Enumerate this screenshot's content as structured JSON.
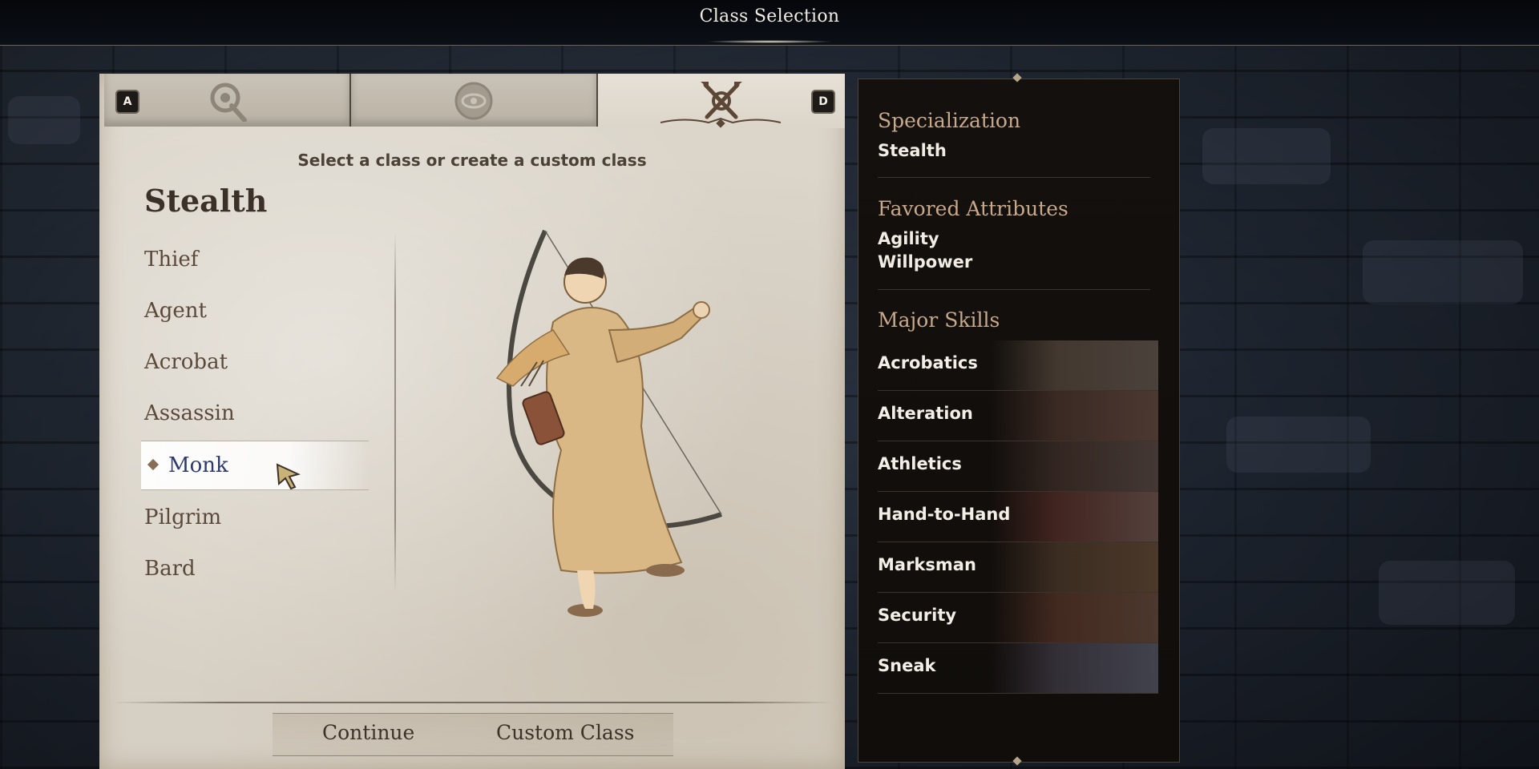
{
  "header": {
    "title": "Class Selection"
  },
  "tabs": {
    "left_key": "A",
    "right_key": "D",
    "items": [
      {
        "icon": "combat-axe-icon"
      },
      {
        "icon": "magic-eye-icon"
      },
      {
        "icon": "stealth-crossed-arrows-icon"
      }
    ],
    "active_index": 2
  },
  "class_panel": {
    "instruction": "Select a class or create a custom class",
    "category": "Stealth",
    "classes": [
      "Thief",
      "Agent",
      "Acrobat",
      "Assassin",
      "Monk",
      "Pilgrim",
      "Bard"
    ],
    "selected": "Monk"
  },
  "footer": {
    "continue_label": "Continue",
    "custom_label": "Custom Class"
  },
  "info_panel": {
    "specialization_title": "Specialization",
    "specialization_value": "Stealth",
    "attributes_title": "Favored Attributes",
    "attributes": [
      "Agility",
      "Willpower"
    ],
    "skills_title": "Major Skills",
    "skills": [
      "Acrobatics",
      "Alteration",
      "Athletics",
      "Hand-to-Hand",
      "Marksman",
      "Security",
      "Sneak"
    ]
  },
  "colors": {
    "parchment": "#d8d1c5",
    "panel_dark": "#120f0c",
    "section_title": "#c8a98b",
    "selected_text": "#2d3a6b"
  }
}
